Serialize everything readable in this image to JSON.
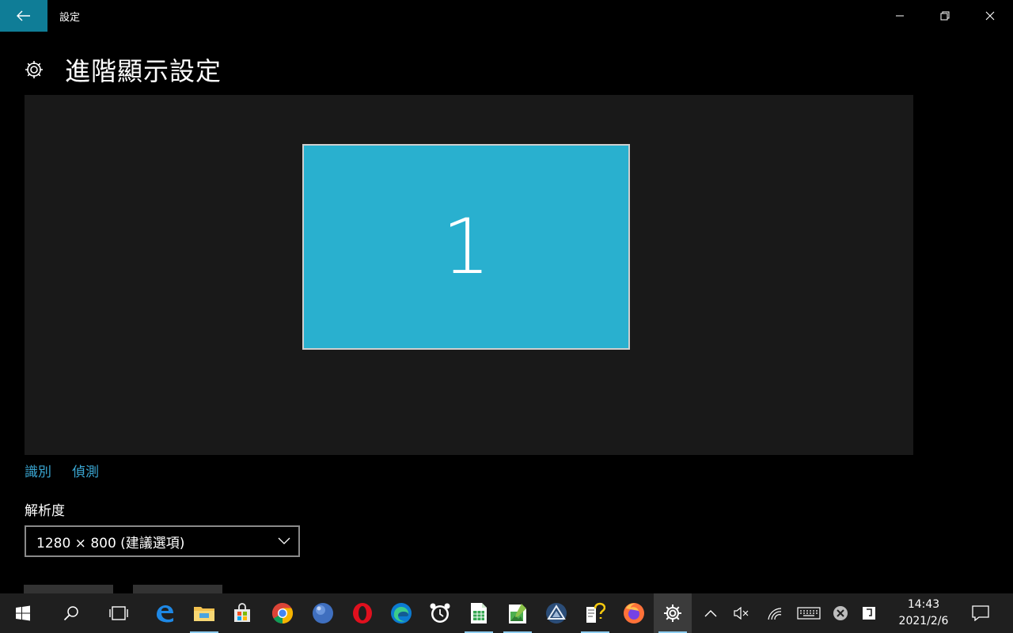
{
  "window": {
    "title": "設定"
  },
  "page": {
    "title": "進階顯示設定"
  },
  "preview": {
    "monitor_number": "1"
  },
  "links": {
    "identify": "識別",
    "detect": "偵測"
  },
  "resolution": {
    "label": "解析度",
    "selected": "1280 × 800 (建議選項)"
  },
  "taskbar": {
    "time": "14:43",
    "date": "2021/2/6"
  },
  "colors": {
    "accent": "#0f7d97",
    "monitor_fill": "#29b0cf",
    "link": "#3aa6d2",
    "taskbar": "#1f1f1f"
  }
}
